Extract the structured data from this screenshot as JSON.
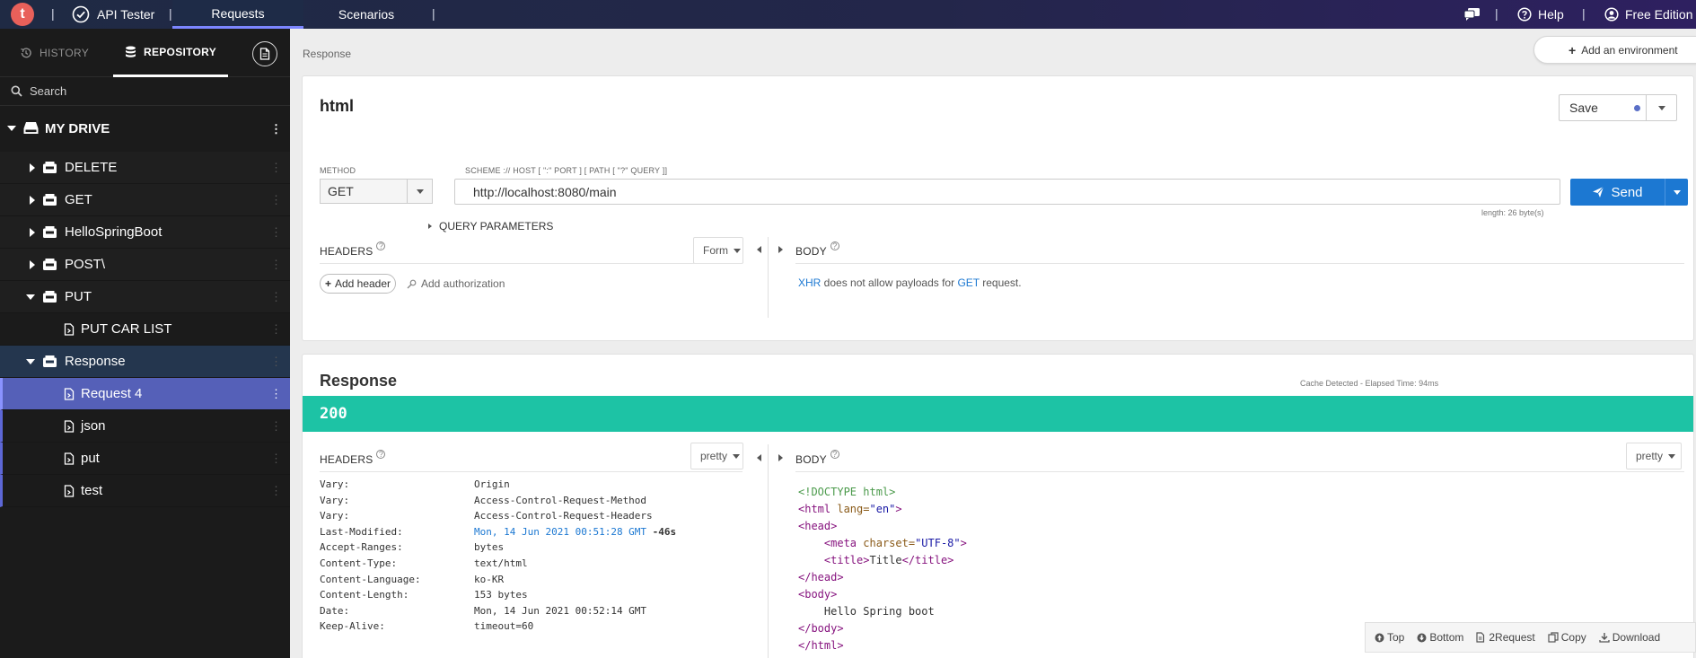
{
  "topbar": {
    "logo_letter": "t",
    "app_name": "API Tester",
    "tabs": [
      {
        "label": "Requests",
        "active": true
      },
      {
        "label": "Scenarios",
        "active": false
      }
    ],
    "chat_icon": "chat-icon",
    "help_label": "Help",
    "edition_label": "Free Edition",
    "separator": "|"
  },
  "sidebar": {
    "tabs": {
      "history": "HISTORY",
      "repository": "REPOSITORY"
    },
    "search_placeholder": "Search",
    "drive_label": "MY DRIVE",
    "items": [
      {
        "label": "DELETE",
        "type": "folder",
        "expanded": false
      },
      {
        "label": "GET",
        "type": "folder",
        "expanded": false
      },
      {
        "label": "HelloSpringBoot",
        "type": "folder",
        "expanded": false
      },
      {
        "label": "POST\\",
        "type": "folder",
        "expanded": false
      },
      {
        "label": "PUT",
        "type": "folder",
        "expanded": true
      },
      {
        "label": "PUT CAR LIST",
        "type": "request"
      },
      {
        "label": "Response",
        "type": "folder",
        "expanded": true
      },
      {
        "label": "Request 4",
        "type": "request",
        "selected": true
      },
      {
        "label": "json",
        "type": "request"
      },
      {
        "label": "put",
        "type": "request"
      },
      {
        "label": "test",
        "type": "request"
      }
    ]
  },
  "main": {
    "breadcrumb": "Response",
    "env_button": "Add an environment",
    "request": {
      "name": "html",
      "save_label": "Save",
      "method_label": "METHOD",
      "method": "GET",
      "url_label": "SCHEME :// HOST [ \":\" PORT ] [ PATH [ \"?\" QUERY ]]",
      "url": "http://localhost:8080/main",
      "send_label": "Send",
      "length_note": "length: 26 byte(s)",
      "query_params": "QUERY PARAMETERS",
      "headers_label": "HEADERS",
      "headers_mode": "Form",
      "add_header": "Add header",
      "add_auth": "Add authorization",
      "body_label": "BODY",
      "body_note_1": "XHR",
      "body_note_2": " does not allow payloads for ",
      "body_note_3": "GET",
      "body_note_4": " request."
    },
    "response": {
      "title": "Response",
      "cache_note": "Cache Detected - Elapsed Time: 94ms",
      "status": "200",
      "headers_label": "HEADERS",
      "headers_mode": "pretty",
      "body_label": "BODY",
      "body_mode": "pretty",
      "headers": [
        {
          "name": "Vary:",
          "value": "Origin"
        },
        {
          "name": "Vary:",
          "value": "Access-Control-Request-Method"
        },
        {
          "name": "Vary:",
          "value": "Access-Control-Request-Headers"
        },
        {
          "name": "Last-Modified:",
          "value": "Mon, 14 Jun 2021 00:51:28 GMT",
          "extra": " -46s"
        },
        {
          "name": "Accept-Ranges:",
          "value": "bytes"
        },
        {
          "name": "Content-Type:",
          "value": "text/html"
        },
        {
          "name": "Content-Language:",
          "value": "ko-KR"
        },
        {
          "name": "Content-Length:",
          "value": "153 bytes"
        },
        {
          "name": "Date:",
          "value": "Mon, 14 Jun 2021 00:52:14 GMT"
        },
        {
          "name": "Keep-Alive:",
          "value": "timeout=60"
        }
      ],
      "body_code": {
        "doctype": "<!DOCTYPE html>",
        "html_open_a": "<html ",
        "html_attr": "lang=",
        "html_str": "\"en\"",
        "html_open_b": ">",
        "head_open": "<head>",
        "meta_a": "<meta ",
        "meta_attr": "charset=",
        "meta_str": "\"UTF-8\"",
        "meta_b": ">",
        "title_open": "<title>",
        "title_text": "Title",
        "title_close": "</title>",
        "head_close": "</head>",
        "body_open": "<body>",
        "body_text": "Hello Spring boot",
        "body_close": "</body>",
        "html_close": "</html>"
      },
      "tools": [
        "Top",
        "Bottom",
        "2Request",
        "Copy",
        "Download"
      ]
    }
  }
}
